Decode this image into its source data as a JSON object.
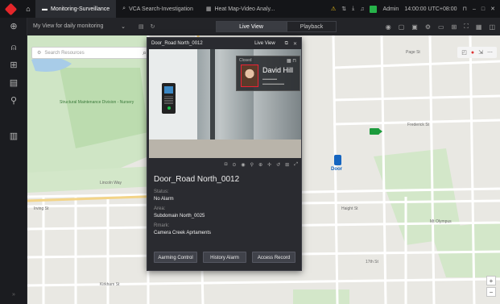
{
  "tabs": [
    {
      "label": "Monitoring-Surveillance",
      "icon": "monitor-icon",
      "active": true
    },
    {
      "label": "VCA Search-Investigation",
      "icon": "search-icon",
      "active": false
    },
    {
      "label": "Heat Map-Video Analy...",
      "icon": "heatmap-icon",
      "active": false
    }
  ],
  "topbar": {
    "user": "Admin",
    "time": "14:00:00 UTC+08:00"
  },
  "subbar": {
    "view_name": "My View for daily monitoring",
    "modes": [
      "Live View",
      "Playback"
    ],
    "active_mode": "Live View"
  },
  "map": {
    "search_placeholder": "Search Resources",
    "labels": [
      "Structural Maintenance Division - Nursery",
      "Lincoln Way",
      "Irving St",
      "Frederick St",
      "17th St",
      "Kirkham St",
      "Door",
      "Mt Olympus",
      "Haight St",
      "Page St"
    ],
    "accent": "#1c9b3c"
  },
  "popup": {
    "title": "Door_Road North_0012",
    "live_view_label": "Live View",
    "face_card": {
      "status_tag": "Closed",
      "name": "David Hill"
    },
    "door_name": "Door_Road North_0012",
    "fields": [
      {
        "label": "Status:",
        "value": "No Alarm"
      },
      {
        "label": "Area:",
        "value": "Subdomain North_0025"
      },
      {
        "label": "Rmark:",
        "value": "Camera Creek Aprtaments"
      }
    ],
    "buttons": [
      "Aarming Control",
      "History Alarm",
      "Access Record"
    ]
  }
}
